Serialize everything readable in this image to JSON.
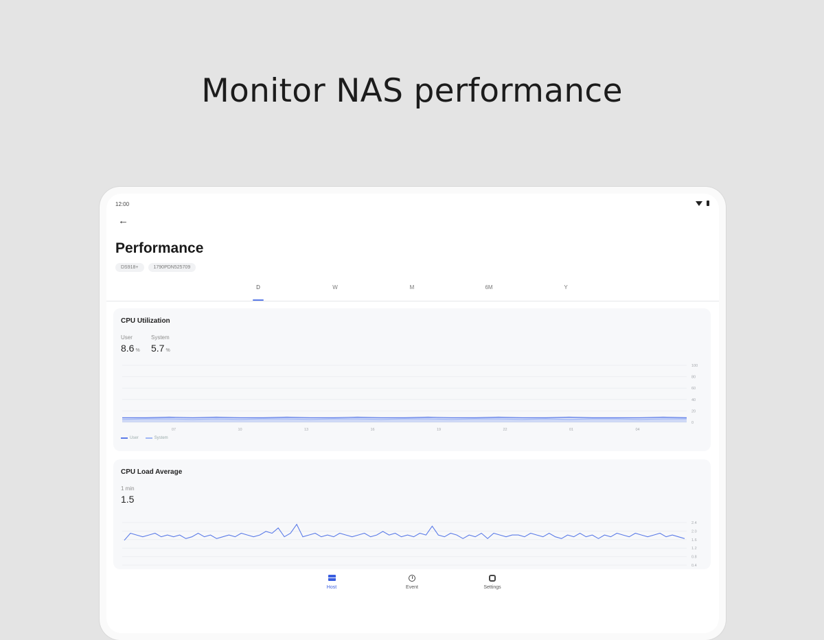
{
  "headline": "Monitor NAS performance",
  "status_bar": {
    "time": "12:00",
    "icons": [
      "wifi-icon",
      "battery-icon"
    ]
  },
  "header": {
    "back_icon": "arrow-left-icon",
    "title": "Performance"
  },
  "chips": [
    "DS918+",
    "1790PDN525709"
  ],
  "tabs": [
    {
      "label": "D",
      "active": true
    },
    {
      "label": "W",
      "active": false
    },
    {
      "label": "M",
      "active": false
    },
    {
      "label": "6M",
      "active": false
    },
    {
      "label": "Y",
      "active": false
    }
  ],
  "cpu_card": {
    "title": "CPU Utilization",
    "metrics": [
      {
        "label": "User",
        "value": "8.6",
        "unit": "%"
      },
      {
        "label": "System",
        "value": "5.7",
        "unit": "%"
      }
    ],
    "legend": [
      {
        "name": "User",
        "color": "#5b7be8"
      },
      {
        "name": "System",
        "color": "#9fb6f5"
      }
    ]
  },
  "load_card": {
    "title": "CPU Load Average",
    "metric": {
      "label": "1 min",
      "value": "1.5"
    }
  },
  "bottom_nav": [
    {
      "label": "Host",
      "icon": "host-icon",
      "active": true
    },
    {
      "label": "Event",
      "icon": "clock-icon",
      "active": false
    },
    {
      "label": "Settings",
      "icon": "gear-icon",
      "active": false
    }
  ],
  "colors": {
    "accent": "#3a5ee0",
    "line": "#5b7be8",
    "line_light": "#9fb6f5"
  },
  "chart_data": [
    {
      "type": "area",
      "title": "CPU Utilization",
      "categories": [
        "07",
        "10",
        "13",
        "16",
        "19",
        "22",
        "01",
        "04"
      ],
      "ylim": [
        0,
        100
      ],
      "yticks": [
        "100",
        "80",
        "60",
        "40",
        "20",
        "0"
      ],
      "grid": true,
      "legend": "bottom-left",
      "series": [
        {
          "name": "User",
          "values": [
            8,
            8,
            9,
            8,
            9,
            8,
            8,
            9,
            8,
            8,
            9,
            8,
            8,
            9,
            8,
            8,
            9,
            8,
            8,
            9,
            8,
            8,
            8,
            9,
            8
          ]
        },
        {
          "name": "System",
          "values": [
            5,
            6,
            6,
            5,
            6,
            5,
            6,
            6,
            5,
            6,
            6,
            5,
            6,
            6,
            5,
            6,
            6,
            5,
            6,
            5,
            6,
            6,
            5,
            6,
            6
          ]
        }
      ]
    },
    {
      "type": "line",
      "title": "CPU Load Average",
      "ylim": [
        0,
        2.4
      ],
      "yticks": [
        "2.4",
        "2.0",
        "1.6",
        "1.2",
        "0.8",
        "0.4"
      ],
      "series": [
        {
          "name": "1 min",
          "values": [
            1.4,
            1.8,
            1.7,
            1.6,
            1.7,
            1.8,
            1.6,
            1.7,
            1.6,
            1.7,
            1.5,
            1.6,
            1.8,
            1.6,
            1.7,
            1.5,
            1.6,
            1.7,
            1.6,
            1.8,
            1.7,
            1.6,
            1.7,
            1.9,
            1.8,
            2.1,
            1.6,
            1.8,
            2.3,
            1.6,
            1.7,
            1.8,
            1.6,
            1.7,
            1.6,
            1.8,
            1.7,
            1.6,
            1.7,
            1.8,
            1.6,
            1.7,
            1.9,
            1.7,
            1.8,
            1.6,
            1.7,
            1.6,
            1.8,
            1.7,
            2.2,
            1.7,
            1.6,
            1.8,
            1.7,
            1.5,
            1.7,
            1.6,
            1.8,
            1.5,
            1.8,
            1.7,
            1.6,
            1.7,
            1.7,
            1.6,
            1.8,
            1.7,
            1.6,
            1.8,
            1.6,
            1.5,
            1.7,
            1.6,
            1.8,
            1.6,
            1.7,
            1.5,
            1.7,
            1.6,
            1.8,
            1.7,
            1.6,
            1.8,
            1.7,
            1.6,
            1.7,
            1.8,
            1.6,
            1.7,
            1.6,
            1.5
          ]
        }
      ]
    }
  ]
}
